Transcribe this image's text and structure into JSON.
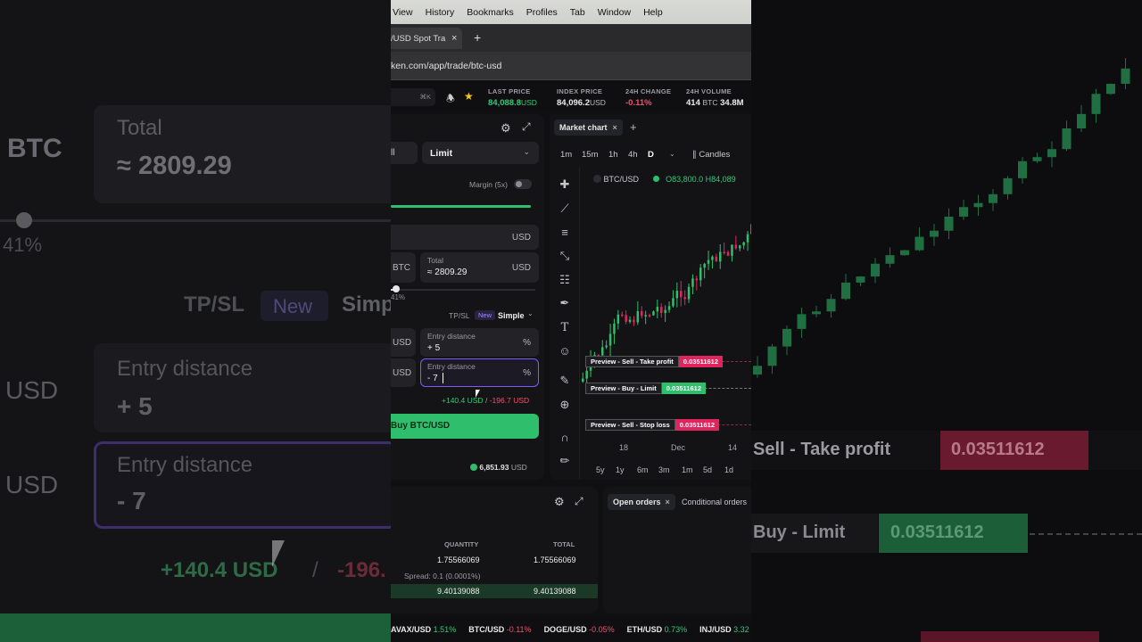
{
  "menu": [
    "View",
    "History",
    "Bookmarks",
    "Profiles",
    "Tab",
    "Window",
    "Help"
  ],
  "tab": {
    "label": "/USD Spot Tra",
    "close": "×",
    "new": "+"
  },
  "url": "ken.com/app/trade/btc-usd",
  "search_shortcut": "⌘K",
  "tickers": {
    "last_price": {
      "label": "LAST PRICE",
      "value": "84,088.8",
      "unit": "USD"
    },
    "index_price": {
      "label": "INDEX PRICE",
      "value": "84,096.2",
      "unit": "USD"
    },
    "change_24h": {
      "label": "24H CHANGE",
      "value": "-0.11%"
    },
    "volume_24h": {
      "label": "24H VOLUME",
      "value": "414",
      "unit": "BTC",
      "extra": "34.8M"
    }
  },
  "order": {
    "side_tab_cut": "ll",
    "type_select": "Limit",
    "margin_label": "Margin (5x)",
    "amount_unit": "USD",
    "qty_unit": "BTC",
    "total_label": "Total",
    "total_value": "≈  2809.29",
    "total_unit": "USD",
    "slider_pct": "41%",
    "slider_fraction": 0.41,
    "tpsl_label": "TP/SL",
    "new_badge": "New",
    "mode_select": "Simple",
    "tp_unit": "USD",
    "tp_label": "Entry distance",
    "tp_value": "+  5",
    "tp_pct": "%",
    "sl_unit": "USD",
    "sl_label": "Entry distance",
    "sl_value": "-  7",
    "sl_pct": "%",
    "pnl_pos": "+140.4",
    "pnl_pos_unit": "USD",
    "pnl_sep": "/",
    "pnl_neg": "-196.7",
    "pnl_neg_unit": "USD",
    "buy_button": "Buy BTC/USD",
    "balance": "6,851.93",
    "balance_unit": "USD"
  },
  "chart": {
    "tab": "Market chart",
    "timeframes": [
      "1m",
      "15m",
      "1h",
      "4h",
      "D"
    ],
    "active_tf": "D",
    "chart_type": "Candles",
    "symbol": "BTC/USD",
    "ohlc": "O83,800.0  H84,089",
    "x_labels": [
      "18",
      "Dec",
      "14"
    ],
    "ranges": [
      "5y",
      "1y",
      "6m",
      "3m",
      "1m",
      "5d",
      "1d"
    ],
    "previews": [
      {
        "label": "Preview - Sell - Take profit",
        "value": "0.03511612",
        "color": "#e0245e"
      },
      {
        "label": "Preview - Buy - Limit",
        "value": "0.03511612",
        "color": "#2fbf6c"
      },
      {
        "label": "Preview - Sell - Stop loss",
        "value": "0.03511612",
        "color": "#e0245e"
      }
    ]
  },
  "book": {
    "col_qty": "QUANTITY",
    "col_total": "TOTAL",
    "rows": [
      {
        "qty": "1.75566069",
        "total": "1.75566069"
      },
      {
        "qty": "9.40139088",
        "total": "9.40139088"
      }
    ],
    "spread": "Spread: 0.1 (0.0001%)"
  },
  "orders_tabs": {
    "open": "Open orders",
    "close": "×",
    "conditional": "Conditional orders"
  },
  "bottom_ticker": [
    {
      "pair": "AVAX/USD",
      "chg": "1.51%",
      "dir": "pos"
    },
    {
      "pair": "BTC/USD",
      "chg": "-0.11%",
      "dir": "neg"
    },
    {
      "pair": "DOGE/USD",
      "chg": "-0.05%",
      "dir": "neg"
    },
    {
      "pair": "ETH/USD",
      "chg": "0.73%",
      "dir": "pos"
    },
    {
      "pair": "INJ/USD",
      "chg": "3.32",
      "dir": "pos"
    }
  ],
  "backdrop": {
    "btc": "BTC",
    "total_label": "Total",
    "total_value": "≈  2809.29",
    "pct": "41%",
    "tpsl": "TP/SL",
    "new": "New",
    "simple": "Simp",
    "usd1": "USD",
    "entry1": "Entry distance",
    "val1": "+  5",
    "usd2": "USD",
    "entry2": "Entry distance",
    "val2": "-  7",
    "pnl": "+140.4 USD",
    "slash": "/",
    "neg": "-196.",
    "sell_tp": "Sell - Take profit",
    "sell_tp_val": "0.03511612",
    "buy_limit": "Buy - Limit",
    "buy_limit_val": "0.03511612"
  },
  "colors": {
    "green": "#2fbf6c",
    "red": "#e0245e",
    "purple": "#7c5cff",
    "accent": "#36c77a"
  }
}
